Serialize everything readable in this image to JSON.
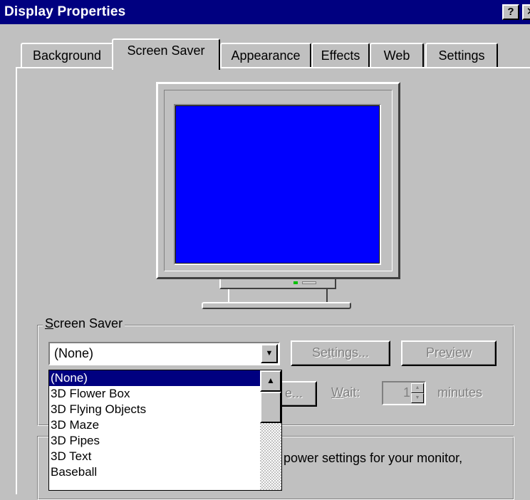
{
  "window": {
    "title": "Display Properties",
    "help_label": "?",
    "close_label": "✕"
  },
  "tabs": [
    {
      "label": "Background",
      "active": false
    },
    {
      "label": "Screen Saver",
      "active": true
    },
    {
      "label": "Appearance",
      "active": false
    },
    {
      "label": "Effects",
      "active": false
    },
    {
      "label": "Web",
      "active": false
    },
    {
      "label": "Settings",
      "active": false
    }
  ],
  "preview": {
    "screen_color": "#0000ff"
  },
  "screen_saver_group": {
    "legend_first": "S",
    "legend_rest": "creen Saver",
    "selected_value": "(None)",
    "dropdown_icon": "down-arrow-icon",
    "settings_first": "Se",
    "settings_underline": "t",
    "settings_rest": "tings...",
    "preview_first": "Pre",
    "preview_underline": "v",
    "preview_rest": "iew",
    "password_button_partial": "e...",
    "wait_underline": "W",
    "wait_rest": "ait:",
    "wait_value": "1",
    "minutes_label": "minutes"
  },
  "dropdown_list": {
    "items": [
      "(None)",
      "3D Flower Box",
      "3D Flying Objects",
      "3D Maze",
      "3D Pipes",
      "3D Text",
      "Baseball"
    ],
    "selected_index": 0
  },
  "energy_group": {
    "text_partial": "power settings for your monitor,"
  }
}
